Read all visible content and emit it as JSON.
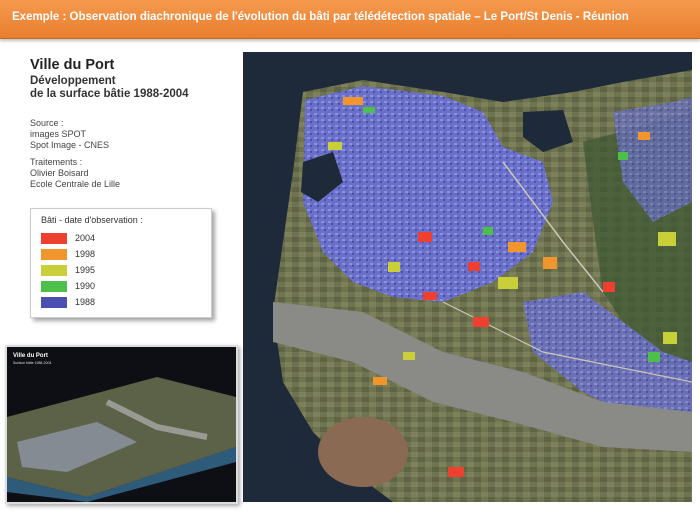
{
  "banner": {
    "text": "Exemple : Observation diachronique de l'évolution du bâti par télédétection spatiale – Le Port/St Denis - Réunion"
  },
  "map_title": "Ville du Port",
  "map_subtitle_line1": "Développement",
  "map_subtitle_line2": "de la surface bâtie 1988-2004",
  "source": {
    "heading": "Source :",
    "line1": "images SPOT",
    "line2": "Spot Image - CNES"
  },
  "processing": {
    "heading": "Traitements :",
    "line1": "Olivier Boisard",
    "line2": "Ecole Centrale de Lille"
  },
  "legend": {
    "title": "Bâti - date d'observation :",
    "items": [
      {
        "label": "2004",
        "color": "#ee4030"
      },
      {
        "label": "1998",
        "color": "#f0962c"
      },
      {
        "label": "1995",
        "color": "#c8cf38"
      },
      {
        "label": "1990",
        "color": "#4cc04a"
      },
      {
        "label": "1988",
        "color": "#4a4fb0"
      }
    ]
  },
  "inset": {
    "title": "Ville du Port",
    "subtitle": "Surface bâtie 1988-2004"
  },
  "colors": {
    "banner": "#f08a3c",
    "sea": "#1e2a3a",
    "land": "#6a6d4c",
    "river": "#8a8a86"
  }
}
